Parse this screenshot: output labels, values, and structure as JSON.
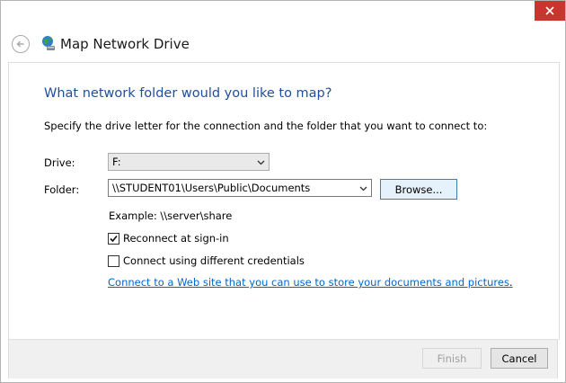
{
  "window": {
    "title": "Map Network Drive"
  },
  "main": {
    "heading": "What network folder would you like to map?",
    "instruction": "Specify the drive letter for the connection and the folder that you want to connect to:",
    "drive": {
      "label": "Drive:",
      "value": "F:"
    },
    "folder": {
      "label": "Folder:",
      "value": "\\\\STUDENT01\\Users\\Public\\Documents"
    },
    "browse_label": "Browse...",
    "example": "Example: \\\\server\\share",
    "reconnect": {
      "label": "Reconnect at sign-in",
      "checked": true
    },
    "different_credentials": {
      "label": "Connect using different credentials",
      "checked": false
    },
    "link_text": "Connect to a Web site that you can use to store your documents and pictures",
    "link_suffix": "."
  },
  "footer": {
    "finish_label": "Finish",
    "cancel_label": "Cancel"
  },
  "colors": {
    "heading": "#1e4e9e",
    "link": "#0066cc",
    "close": "#c7372f"
  },
  "icons": [
    "close-icon",
    "back-arrow-icon",
    "network-drive-icon",
    "chevron-down-icon",
    "checkmark-icon"
  ]
}
